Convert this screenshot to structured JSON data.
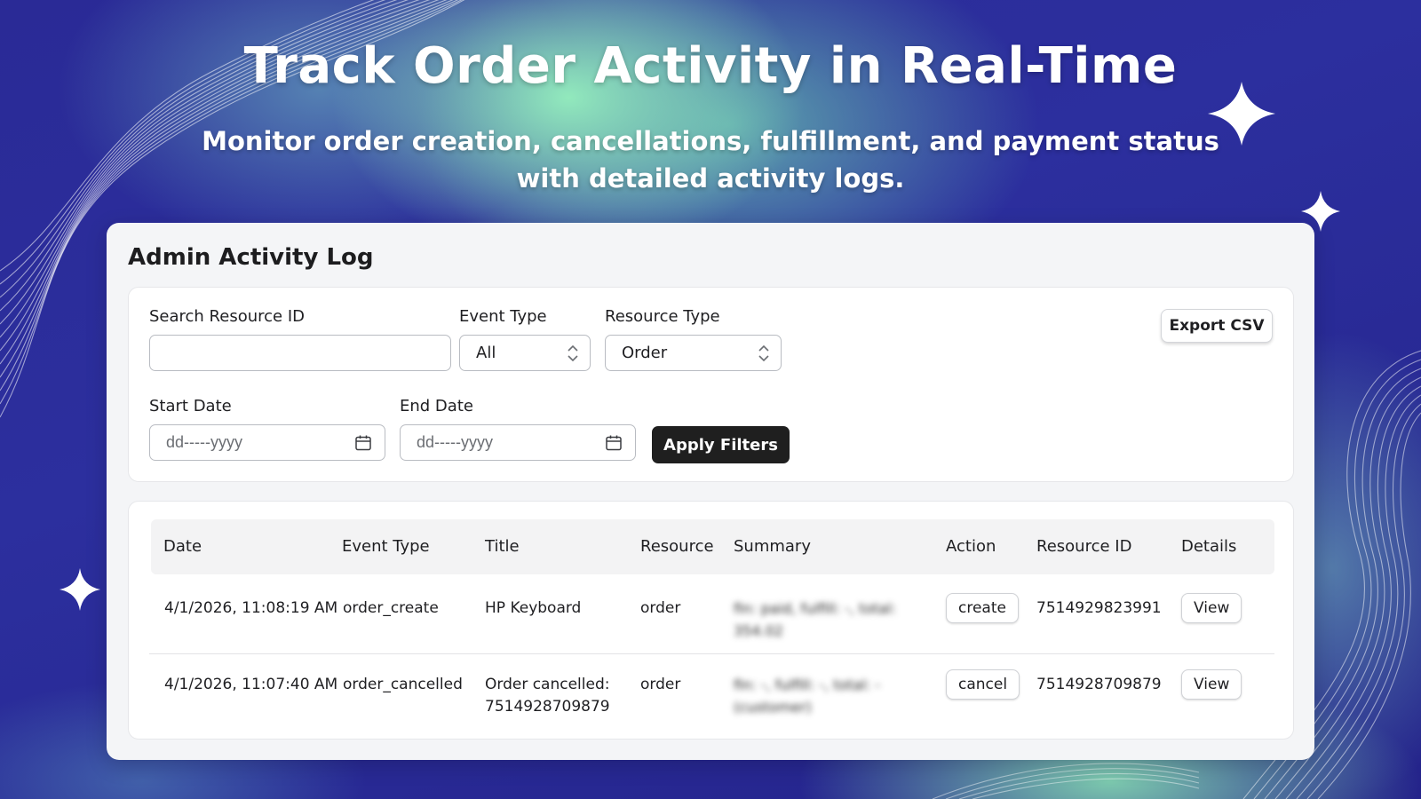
{
  "hero": {
    "title": "Track Order Activity in Real-Time",
    "subtitle_line1": "Monitor order creation, cancellations, fulfillment, and payment status",
    "subtitle_line2": "with detailed activity logs."
  },
  "panel": {
    "title": "Admin Activity Log"
  },
  "filters": {
    "search_label": "Search Resource ID",
    "search_value": "",
    "event_type_label": "Event Type",
    "event_type_value": "All",
    "resource_type_label": "Resource Type",
    "resource_type_value": "Order",
    "start_date_label": "Start Date",
    "start_date_placeholder": "dd-----yyyy",
    "end_date_label": "End Date",
    "end_date_placeholder": "dd-----yyyy",
    "apply_label": "Apply Filters",
    "export_label": "Export CSV"
  },
  "table": {
    "headers": [
      "Date",
      "Event Type",
      "Title",
      "Resource",
      "Summary",
      "Action",
      "Resource ID",
      "Details"
    ],
    "rows": [
      {
        "date": "4/1/2026, 11:08:19 AM",
        "event_type": "order_create",
        "title_line1": "HP Keyboard",
        "title_line2": "",
        "resource": "order",
        "summary_line1": "fin: paid, fulfill: -, total:",
        "summary_line2": "354.02",
        "action": "create",
        "resource_id": "7514929823991",
        "details": "View"
      },
      {
        "date": "4/1/2026, 11:07:40 AM",
        "event_type": "order_cancelled",
        "title_line1": "Order cancelled:",
        "title_line2": "7514928709879",
        "resource": "order",
        "summary_line1": "fin: -, fulfill: -, total: -",
        "summary_line2": "(customer)",
        "action": "cancel",
        "resource_id": "7514928709879",
        "details": "View"
      }
    ]
  },
  "icons": {
    "sparkle": "sparkle-icon",
    "calendar": "calendar-icon",
    "select_chevrons": "chevron-updown-icon"
  }
}
